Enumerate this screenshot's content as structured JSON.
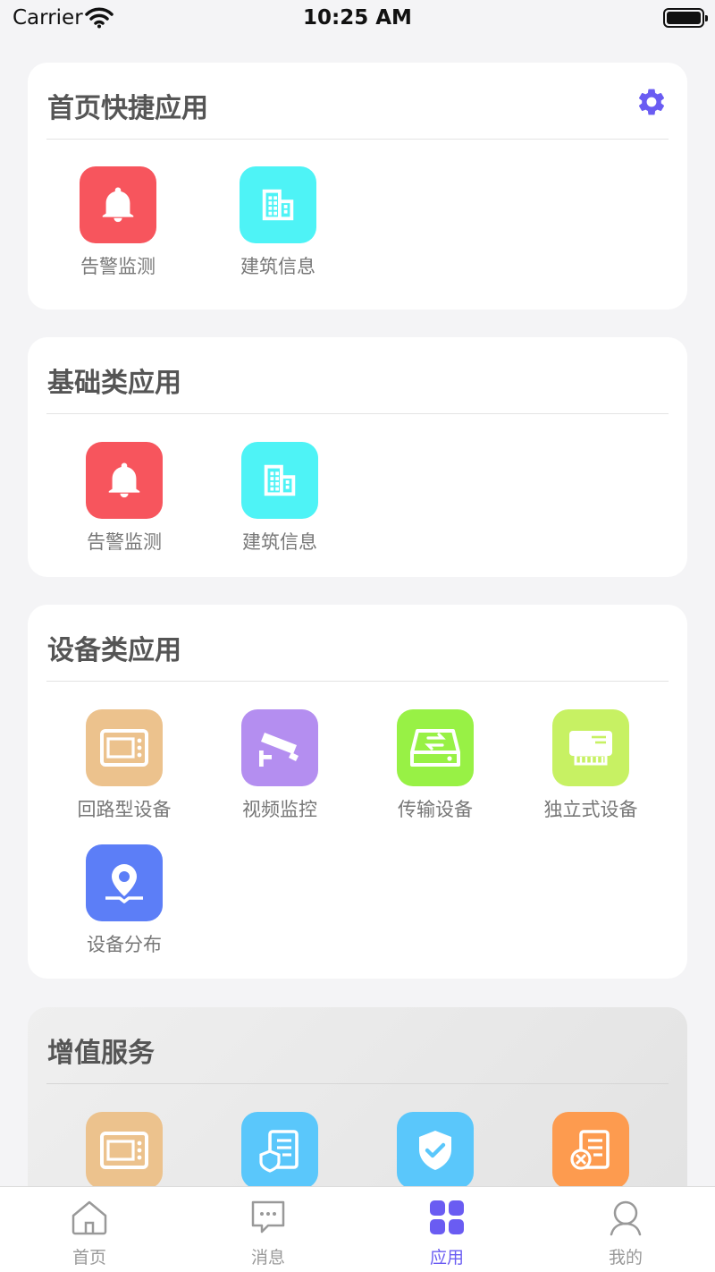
{
  "status_bar": {
    "carrier": "Carrier",
    "time": "10:25 AM"
  },
  "colors": {
    "accent": "#6a5cf2",
    "red": "#f7555d",
    "cyan": "#4ef3f6",
    "tan": "#ecc28d",
    "purple": "#b48ef0",
    "green": "#98f145",
    "lime": "#c7f163",
    "blue": "#5c7ef7",
    "sky": "#5ac7fb",
    "orange": "#fd9b4f"
  },
  "sections": {
    "quick": {
      "title": "首页快捷应用",
      "apps": [
        {
          "label": "告警监测",
          "icon": "bell-icon"
        },
        {
          "label": "建筑信息",
          "icon": "building-icon"
        }
      ]
    },
    "basic": {
      "title": "基础类应用",
      "apps": [
        {
          "label": "告警监测",
          "icon": "bell-icon"
        },
        {
          "label": "建筑信息",
          "icon": "building-icon"
        }
      ]
    },
    "device": {
      "title": "设备类应用",
      "apps": [
        {
          "label": "回路型设备",
          "icon": "panel-device-icon"
        },
        {
          "label": "视频监控",
          "icon": "camera-icon"
        },
        {
          "label": "传输设备",
          "icon": "transfer-device-icon"
        },
        {
          "label": "独立式设备",
          "icon": "standalone-device-icon"
        },
        {
          "label": "设备分布",
          "icon": "location-pin-icon"
        }
      ]
    },
    "value_added": {
      "title": "增值服务",
      "apps": [
        {
          "icon": "panel-device-icon"
        },
        {
          "icon": "doc-shield-icon"
        },
        {
          "icon": "shield-check-icon"
        },
        {
          "icon": "doc-repair-icon"
        }
      ]
    }
  },
  "tab_bar": {
    "tabs": [
      {
        "label": "首页",
        "icon": "home-icon"
      },
      {
        "label": "消息",
        "icon": "message-icon"
      },
      {
        "label": "应用",
        "icon": "apps-grid-icon",
        "active": true
      },
      {
        "label": "我的",
        "icon": "user-icon"
      }
    ]
  }
}
